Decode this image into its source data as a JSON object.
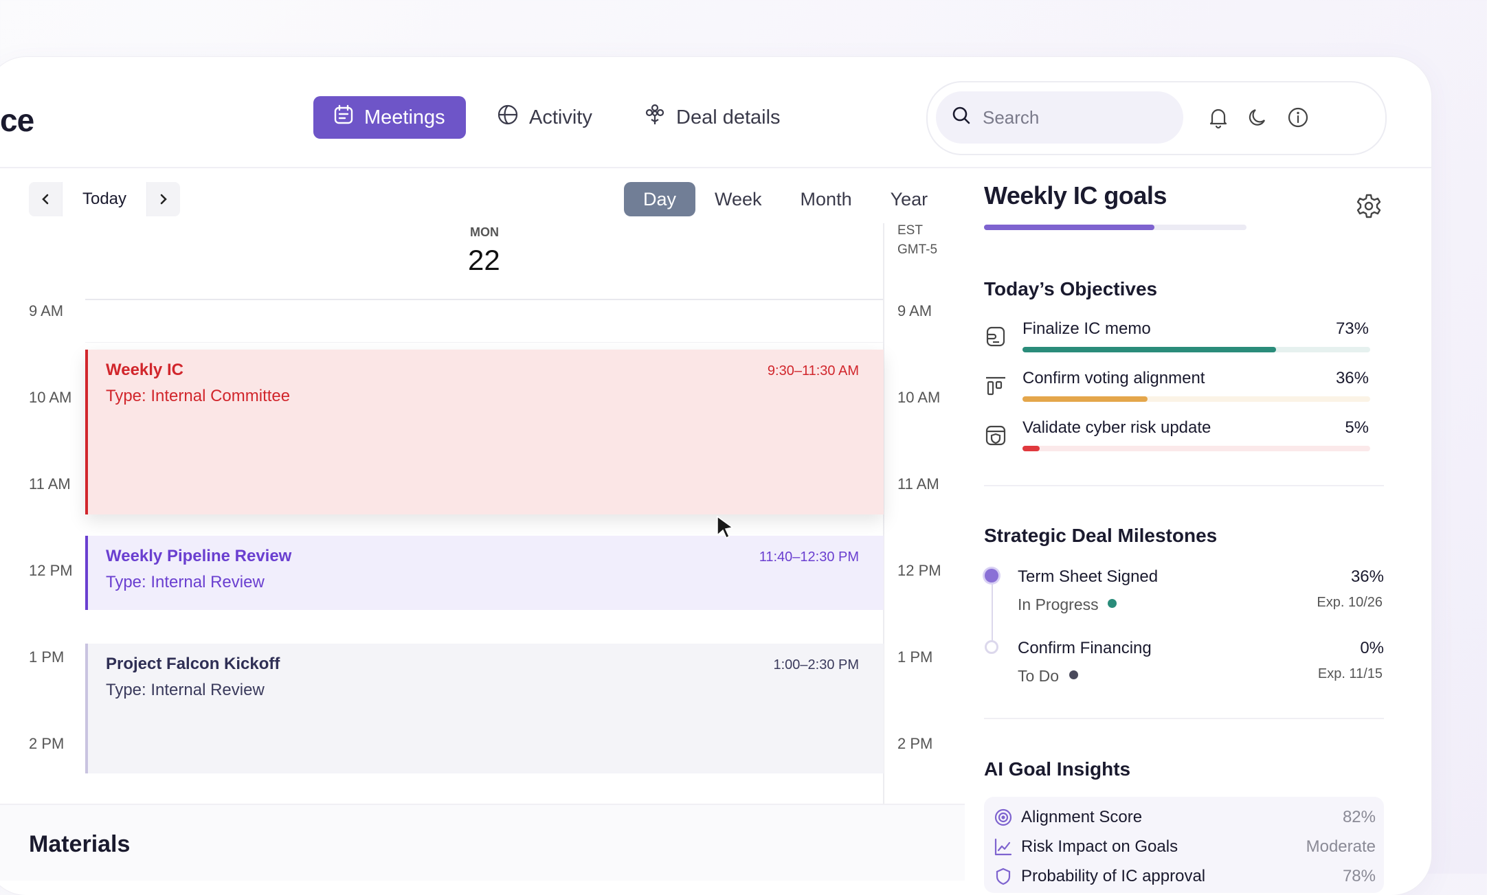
{
  "brand": {
    "title": "ce"
  },
  "tabs": [
    {
      "label": "Meetings",
      "icon": "calendar-icon",
      "active": true
    },
    {
      "label": "Activity",
      "icon": "globe-icon",
      "active": false
    },
    {
      "label": "Deal details",
      "icon": "flower-icon",
      "active": false
    }
  ],
  "search": {
    "placeholder": "Search"
  },
  "calendar": {
    "today_label": "Today",
    "views": [
      "Day",
      "Week",
      "Month",
      "Year"
    ],
    "active_view": "Day",
    "day_name": "MON",
    "day_number": "22",
    "timezone_line1": "EST",
    "timezone_line2": "GMT-5",
    "hours": [
      "9 AM",
      "10 AM",
      "11 AM",
      "12 PM",
      "1 PM",
      "2 PM"
    ],
    "events": [
      {
        "title": "Weekly IC",
        "type": "Type: Internal Committee",
        "time": "9:30–11:30 AM",
        "color": "#d1262c",
        "bg": "#fbe6e6"
      },
      {
        "title": "Weekly Pipeline Review",
        "type": "Type: Internal Review",
        "time": "11:40–12:30 PM",
        "color": "#6a3fd0",
        "bg": "#f1eefc"
      },
      {
        "title": "Project Falcon Kickoff",
        "type": "Type: Internal Review",
        "time": "1:00–2:30 PM",
        "color": "#3a3a5c",
        "bg": "#f4f4f8"
      }
    ]
  },
  "materials": {
    "title": "Materials"
  },
  "goals": {
    "title": "Weekly IC goals",
    "progress": 0.65,
    "objectives_title": "Today’s Objectives",
    "objectives": [
      {
        "label": "Finalize IC memo",
        "pct": "73%",
        "value": 0.73,
        "color": "#2a8c7a",
        "track": "#e6f1ef",
        "icon": "memo-icon"
      },
      {
        "label": "Confirm voting alignment",
        "pct": "36%",
        "value": 0.36,
        "color": "#e4a64b",
        "track": "#fbf3e6",
        "icon": "align-icon"
      },
      {
        "label": "Validate cyber risk update",
        "pct": "5%",
        "value": 0.05,
        "color": "#e0393e",
        "track": "#fbe9ea",
        "icon": "shield-browser-icon"
      }
    ],
    "milestones_title": "Strategic Deal Milestones",
    "milestones": [
      {
        "label": "Term Sheet Signed",
        "pct": "36%",
        "status": "In Progress",
        "status_color": "#2a8c7a",
        "exp": "Exp. 10/26"
      },
      {
        "label": "Confirm Financing",
        "pct": "0%",
        "status": "To Do",
        "status_color": "#4a4a5c",
        "exp": "Exp. 11/15"
      }
    ],
    "insights_title": "AI Goal Insights",
    "insights": [
      {
        "label": "Alignment Score",
        "value": "82%",
        "icon": "target-icon"
      },
      {
        "label": "Risk Impact on Goals",
        "value": "Moderate",
        "icon": "line-chart-icon"
      },
      {
        "label": "Probability of IC approval",
        "value": "78%",
        "icon": "shield-icon"
      }
    ]
  }
}
